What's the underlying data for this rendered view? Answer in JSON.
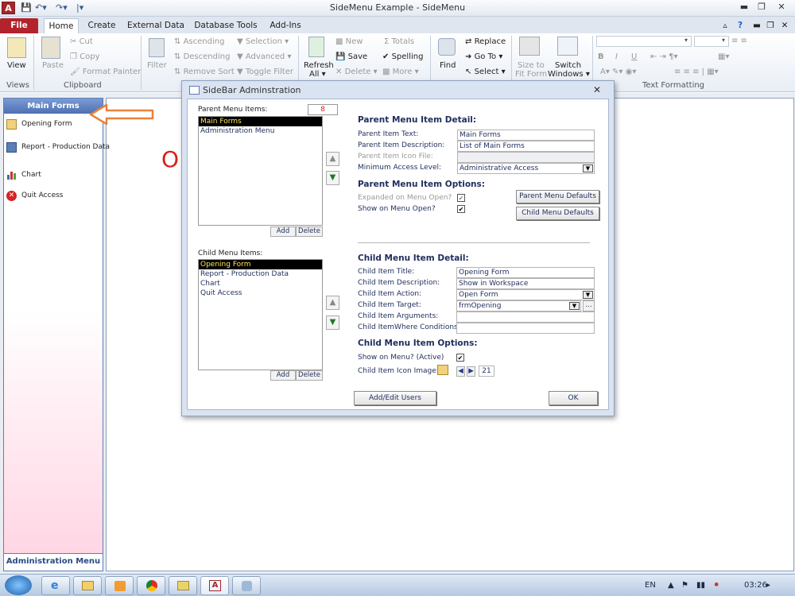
{
  "titlebar": {
    "app_icon": "A",
    "title": "SideMenu Example - SideMenu",
    "qat": [
      "save-icon",
      "undo-icon",
      "redo-icon",
      "customize-icon"
    ]
  },
  "tabs": [
    "File",
    "Home",
    "Create",
    "External Data",
    "Database Tools",
    "Add-Ins"
  ],
  "ribbon": {
    "views": {
      "label": "Views",
      "view": "View"
    },
    "clipboard": {
      "label": "Clipboard",
      "paste": "Paste",
      "cut": "Cut",
      "copy": "Copy",
      "format_painter": "Format Painter"
    },
    "sort": {
      "filter": "Filter",
      "ascending": "Ascending",
      "descending": "Descending",
      "remove_sort": "Remove Sort",
      "selection": "Selection",
      "advanced": "Advanced",
      "toggle_filter": "Toggle Filter"
    },
    "records": {
      "refresh": "Refresh",
      "refresh_all": "All",
      "new": "New",
      "save": "Save",
      "delete": "Delete",
      "totals": "Totals",
      "spelling": "Spelling",
      "more": "More"
    },
    "find": {
      "find": "Find",
      "replace": "Replace",
      "goto": "Go To",
      "select": "Select"
    },
    "window": {
      "size_to_fit": "Size to",
      "fit_form": "Fit Form",
      "switch": "Switch",
      "switch_windows": "Windows"
    },
    "text_formatting": {
      "label": "Text Formatting"
    }
  },
  "sidemenu": {
    "header": "Main Forms",
    "items": [
      {
        "label": "Opening Form",
        "icon": "folder-form-icon"
      },
      {
        "label": "Report - Production Data",
        "icon": "report-icon"
      },
      {
        "label": "Chart",
        "icon": "chart-icon"
      },
      {
        "label": "Quit Access",
        "icon": "quit-icon"
      }
    ],
    "footer": "Administration Menu"
  },
  "annotation": {
    "letter": "O",
    "arrow_color": "#e8823a"
  },
  "dialog": {
    "title": "SideBar Adminstration",
    "parent_list_label": "Parent Menu Items:",
    "parent_count": "8",
    "parent_items": [
      "Main Forms",
      "Administration Menu"
    ],
    "parent_selected": 0,
    "add": "Add",
    "delete": "Delete",
    "parent_detail_heading": "Parent Menu Item Detail:",
    "parent_fields": [
      {
        "label": "Parent Item Text:",
        "value": "Main Forms"
      },
      {
        "label": "Parent Item Description:",
        "value": "List of Main Forms"
      },
      {
        "label": "Parent Item Icon File:",
        "value": ""
      },
      {
        "label": "Minimum Access Level:",
        "value": "Administrative Access"
      }
    ],
    "parent_options_heading": "Parent Menu Item Options:",
    "expanded_label": "Expanded on Menu Open?",
    "expanded_checked": "✔",
    "show_on_open_label": "Show on Menu Open?",
    "show_on_open_checked": "✔",
    "parent_defaults_btn": "Parent Menu Defaults",
    "child_defaults_btn": "Child Menu Defaults",
    "child_list_label": "Child Menu Items:",
    "child_items": [
      "Opening Form",
      "Report - Production Data",
      "Chart",
      "Quit Access"
    ],
    "child_detail_heading": "Child Menu Item Detail:",
    "child_fields": [
      {
        "label": "Child Item Title:",
        "value": "Opening Form"
      },
      {
        "label": "Child Item Description:",
        "value": "Show in Workspace"
      },
      {
        "label": "Child Item Action:",
        "value": "Open Form"
      },
      {
        "label": "Child Item Target:",
        "value": "frmOpening"
      },
      {
        "label": "Child Item Arguments:",
        "value": ""
      },
      {
        "label": "Child ItemWhere Conditions:",
        "value": ""
      }
    ],
    "child_options_heading": "Child Menu Item Options:",
    "show_on_menu_label": "Show on Menu? (Active)",
    "show_on_menu_checked": "✔",
    "icon_image_label": "Child Item Icon Image:",
    "icon_index": "21",
    "add_edit_users": "Add/Edit Users",
    "ok": "OK"
  },
  "taskbar": {
    "lang": "EN",
    "time": "03:26"
  }
}
